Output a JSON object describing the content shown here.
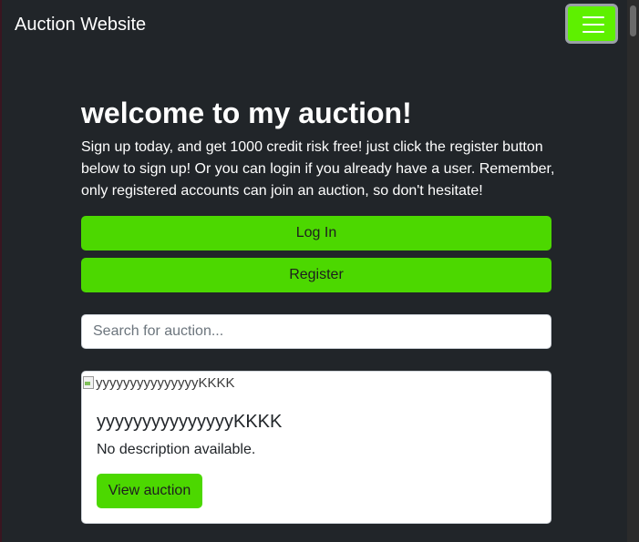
{
  "navbar": {
    "brand": "Auction Website",
    "toggler_icon": "hamburger-menu-icon"
  },
  "hero": {
    "title": "welcome to my auction!",
    "intro": "Sign up today, and get 1000 credit risk free! just click the register button below to sign up! Or you can login if you already have a user. Remember, only registered accounts can join an auction, so don't hesitate!",
    "login_label": "Log In",
    "register_label": "Register"
  },
  "search": {
    "placeholder": "Search for auction..."
  },
  "auctions": [
    {
      "image_alt": "yyyyyyyyyyyyyyyKKKK",
      "title": "yyyyyyyyyyyyyyyKKKK",
      "description": "No description available.",
      "button_label": "View auction"
    }
  ],
  "colors": {
    "background": "#212529",
    "accent": "#4cd800",
    "toggler": "#5ef000"
  }
}
